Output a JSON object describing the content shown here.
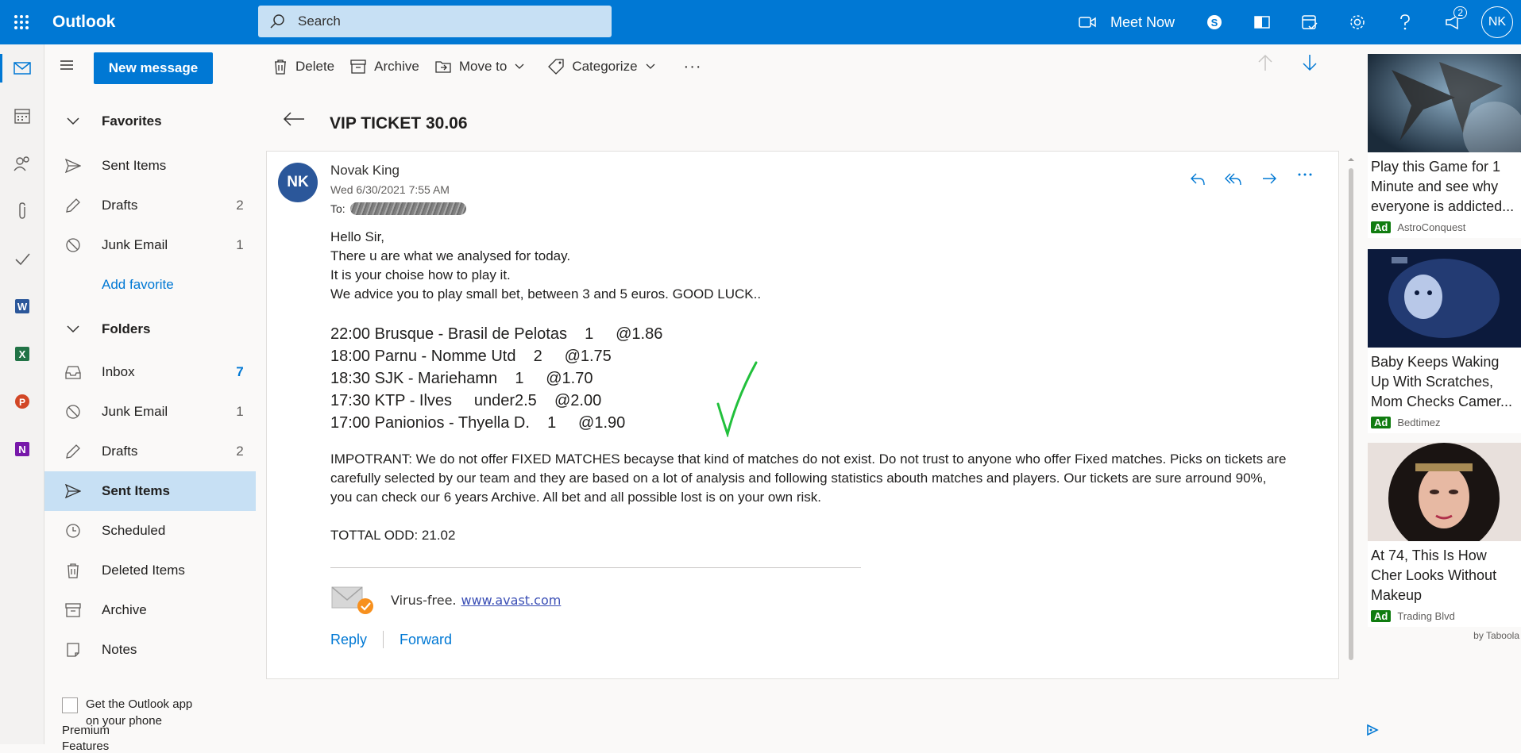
{
  "app": {
    "name": "Outlook"
  },
  "search": {
    "placeholder": "Search"
  },
  "topbar": {
    "meet_now": "Meet Now",
    "notif_count": "2",
    "avatar": "NK"
  },
  "new_message": "New message",
  "favorites": {
    "header": "Favorites",
    "items": [
      {
        "label": "Sent Items",
        "count": ""
      },
      {
        "label": "Drafts",
        "count": "2"
      },
      {
        "label": "Junk Email",
        "count": "1"
      }
    ],
    "add": "Add favorite"
  },
  "folders": {
    "header": "Folders",
    "items": [
      {
        "label": "Inbox",
        "count": "7"
      },
      {
        "label": "Junk Email",
        "count": "1"
      },
      {
        "label": "Drafts",
        "count": "2"
      },
      {
        "label": "Sent Items",
        "count": ""
      },
      {
        "label": "Scheduled",
        "count": ""
      },
      {
        "label": "Deleted Items",
        "count": ""
      },
      {
        "label": "Archive",
        "count": ""
      },
      {
        "label": "Notes",
        "count": ""
      }
    ]
  },
  "get_app": {
    "line1": "Get the Outlook app",
    "line2": "on your phone",
    "line3": "Premium",
    "line4": "Features"
  },
  "commands": {
    "delete": "Delete",
    "archive": "Archive",
    "move_to": "Move to",
    "categorize": "Categorize",
    "more": "···"
  },
  "message": {
    "subject": "VIP TICKET 30.06",
    "avatar": "NK",
    "sender": "Novak King",
    "date": "Wed 6/30/2021 7:55 AM",
    "to_label": "To:",
    "greeting": "Hello Sir,",
    "lines": [
      "There u are what we analysed for today.",
      "It is your choise how to play it.",
      "We advice you to play small bet, between 3 and 5 euros. GOOD LUCK.."
    ],
    "picks": [
      "22:00 Brusque - Brasil de Pelotas    1     @1.86",
      "18:00 Parnu - Nomme Utd    2     @1.75",
      "18:30 SJK - Mariehamn    1     @1.70",
      "17:30 KTP - Ilves     under2.5    @2.00",
      "17:00 Panionios - Thyella D.    1     @1.90"
    ],
    "important": "IMPOTRANT: We do not offer FIXED MATCHES becayse that kind of matches do not exist. Do not trust to anyone who offer Fixed matches. Picks on tickets are carefully selected by our team and they are based on a lot of analysis and following statistics abouth matches and players. Our tickets are sure arround 90%, you can check our 6 years Archive. All bet and all possible lost is on your own risk.",
    "total": "TOTTAL ODD: 21.02",
    "signature_text": "Virus-free.",
    "signature_link": "www.avast.com",
    "reply": "Reply",
    "forward": "Forward"
  },
  "ads": [
    {
      "title": "Play this Game for 1 Minute and see why everyone is addicted...",
      "tag": "Ad",
      "source": "AstroConquest"
    },
    {
      "title": "Baby Keeps Waking Up With Scratches, Mom Checks Camer...",
      "tag": "Ad",
      "source": "Bedtimez"
    },
    {
      "title": "At 74, This Is How Cher Looks Without Makeup",
      "tag": "Ad",
      "source": "Trading Blvd"
    }
  ],
  "ads_footer": "by Taboola",
  "colors": {
    "brand": "#0078d4",
    "selected": "#c7e0f4",
    "ad_tag": "#107c10"
  }
}
